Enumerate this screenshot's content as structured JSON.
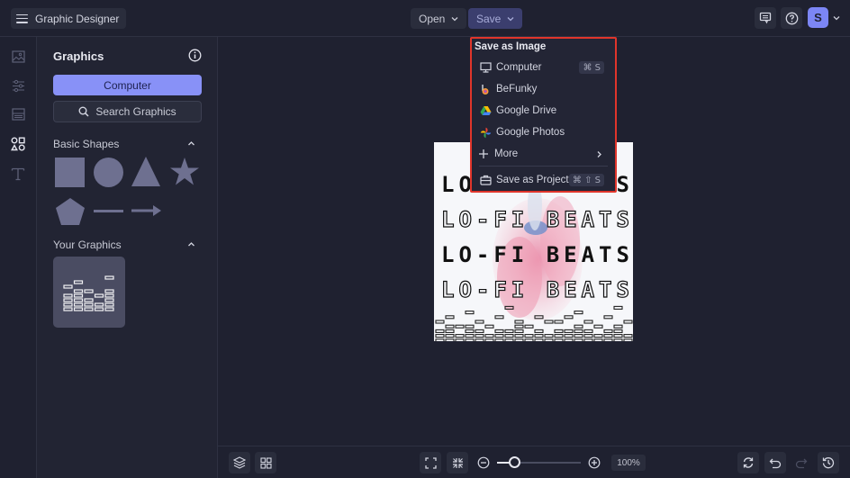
{
  "topbar": {
    "app_title": "Graphic Designer",
    "open_label": "Open",
    "save_label": "Save",
    "avatar_initial": "S",
    "icons": [
      "menu-icon",
      "comment-icon",
      "help-icon",
      "chevron-down-icon"
    ]
  },
  "rail": {
    "items": [
      {
        "name": "image",
        "icon": "image-icon"
      },
      {
        "name": "adjustments",
        "icon": "sliders-icon"
      },
      {
        "name": "layouts",
        "icon": "layout-icon"
      },
      {
        "name": "graphics",
        "icon": "shapes-icon",
        "active": true
      },
      {
        "name": "text",
        "icon": "text-icon"
      }
    ]
  },
  "panel": {
    "title": "Graphics",
    "computer_button": "Computer",
    "search_button": "Search Graphics",
    "basic_shapes": {
      "label": "Basic Shapes",
      "shapes": [
        "square",
        "circle",
        "triangle",
        "star",
        "pentagon",
        "line",
        "arrow"
      ]
    },
    "your_graphics": {
      "label": "Your Graphics",
      "items": [
        "equalizer-bars-graphic"
      ]
    }
  },
  "save_menu": {
    "header": "Save as Image",
    "items": [
      {
        "label": "Computer",
        "icon": "monitor-icon",
        "shortcut": "⌘ S"
      },
      {
        "label": "BeFunky",
        "icon": "befunky-icon"
      },
      {
        "label": "Google Drive",
        "icon": "google-drive-icon"
      },
      {
        "label": "Google Photos",
        "icon": "google-photos-icon"
      },
      {
        "label": "More",
        "icon": "plus-icon",
        "submenu": true
      }
    ],
    "project": {
      "label": "Save as Project",
      "icon": "briefcase-icon",
      "shortcut": "⌘ ⇧ S"
    },
    "highlight_color": "#e0352b"
  },
  "artboard": {
    "lines": [
      "LO-FI BEATS",
      "LO-FI BEATS",
      "LO-FI BEATS",
      "LO-FI BEATS"
    ]
  },
  "bottombar": {
    "zoom_level": "100%",
    "zoom_fraction": 0.2
  },
  "colors": {
    "accent": "#8891f7",
    "background": "#1f2130",
    "panel": "#222433"
  }
}
